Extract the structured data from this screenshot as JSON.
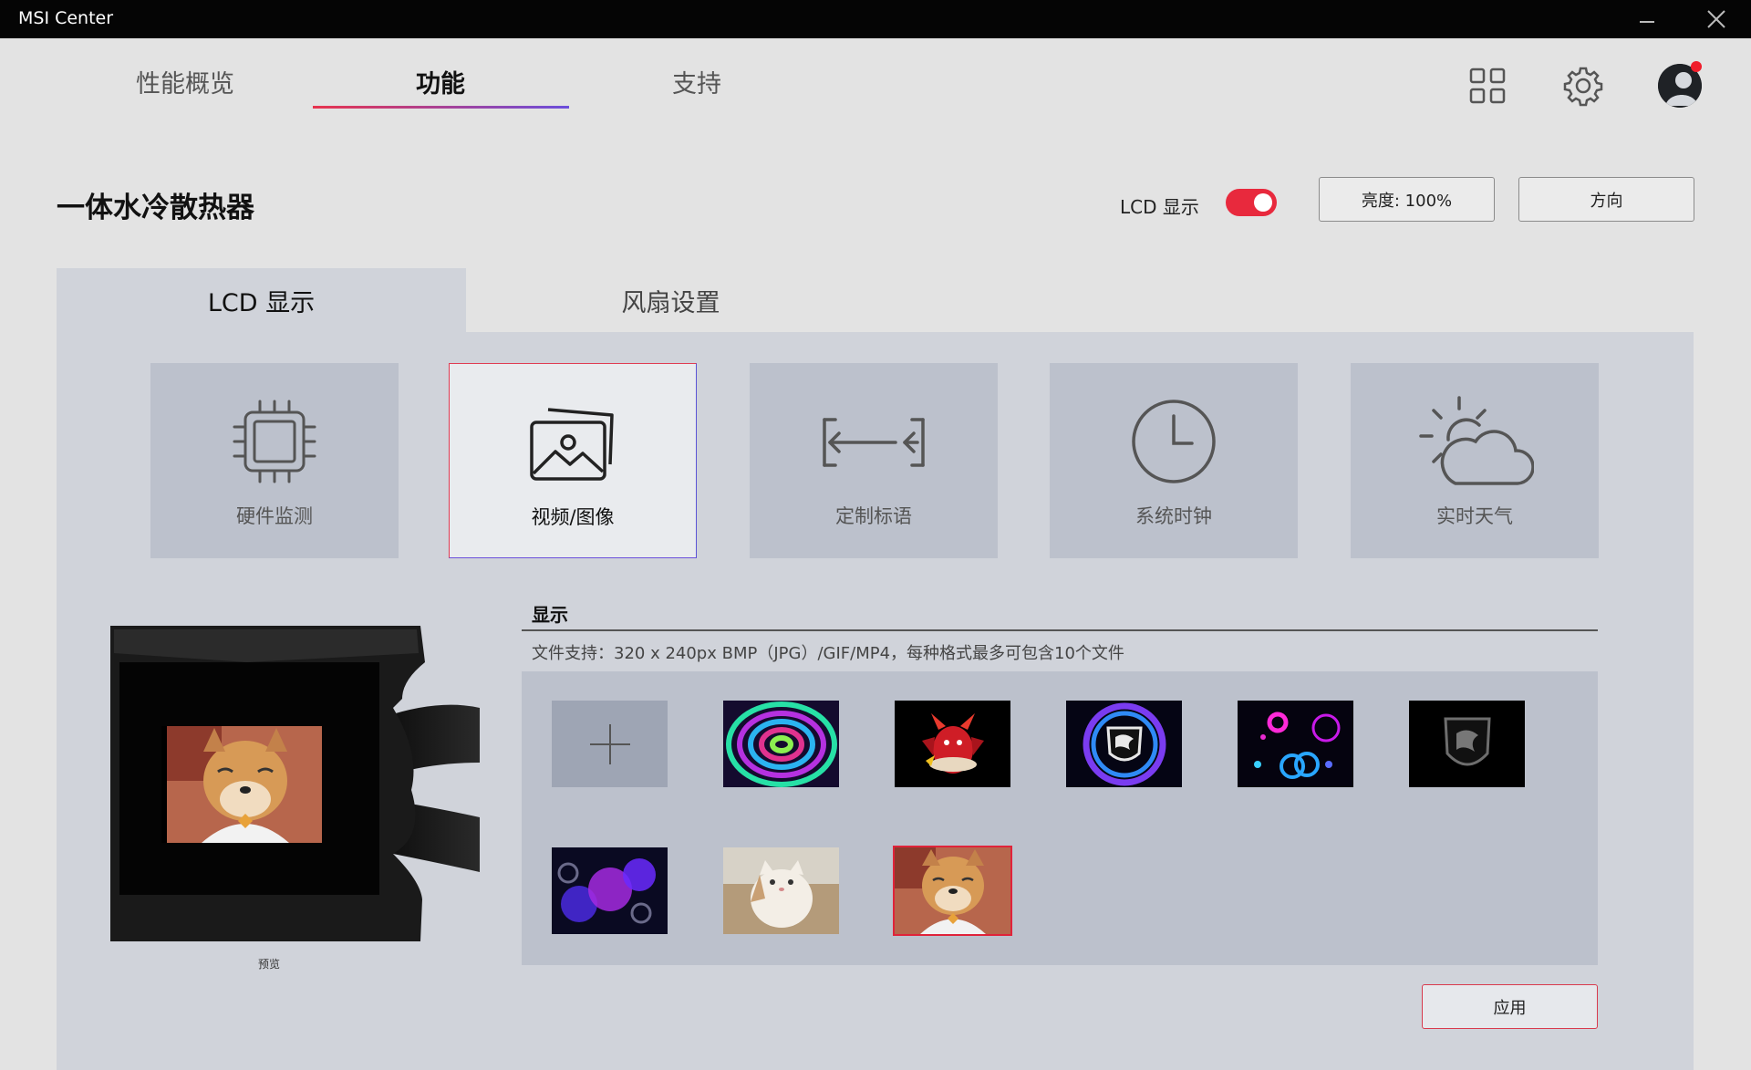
{
  "window": {
    "title": "MSI Center"
  },
  "nav": {
    "tabs": [
      {
        "label": "性能概览"
      },
      {
        "label": "功能"
      },
      {
        "label": "支持"
      }
    ],
    "active": 1
  },
  "page": {
    "title": "一体水冷散热器",
    "lcd_toggle": {
      "label": "LCD 显示",
      "on": true
    },
    "brightness_button": "亮度: 100%",
    "direction_button": "方向"
  },
  "sub_tabs": [
    {
      "label": "LCD 显示"
    },
    {
      "label": "风扇设置"
    }
  ],
  "features": [
    {
      "label": "硬件监测",
      "icon": "cpu-chip-icon"
    },
    {
      "label": "视频/图像",
      "icon": "image-icon",
      "selected": true
    },
    {
      "label": "定制标语",
      "icon": "banner-arrows-icon"
    },
    {
      "label": "系统时钟",
      "icon": "clock-icon"
    },
    {
      "label": "实时天气",
      "icon": "weather-icon"
    }
  ],
  "preview": {
    "caption": "预览"
  },
  "display_section": {
    "title": "显示",
    "support_text": "文件支持：320 x 240px BMP（JPG）/GIF/MP4，每种格式最多可包含10个文件"
  },
  "thumbnails": [
    {
      "name": "add-file",
      "icon": "plus-icon"
    },
    {
      "name": "neon-swirl"
    },
    {
      "name": "red-dragon"
    },
    {
      "name": "msi-ring-logo"
    },
    {
      "name": "neon-circles"
    },
    {
      "name": "msi-shield-logo"
    },
    {
      "name": "purple-bubbles"
    },
    {
      "name": "cat-photo"
    },
    {
      "name": "shiba-dog-photo",
      "selected": true
    }
  ],
  "apply_button": "应用",
  "colors": {
    "accent": "#e8293d",
    "accent_secondary": "#6b4fdc",
    "panel": "#d0d3da",
    "card": "#bcc1cc"
  }
}
